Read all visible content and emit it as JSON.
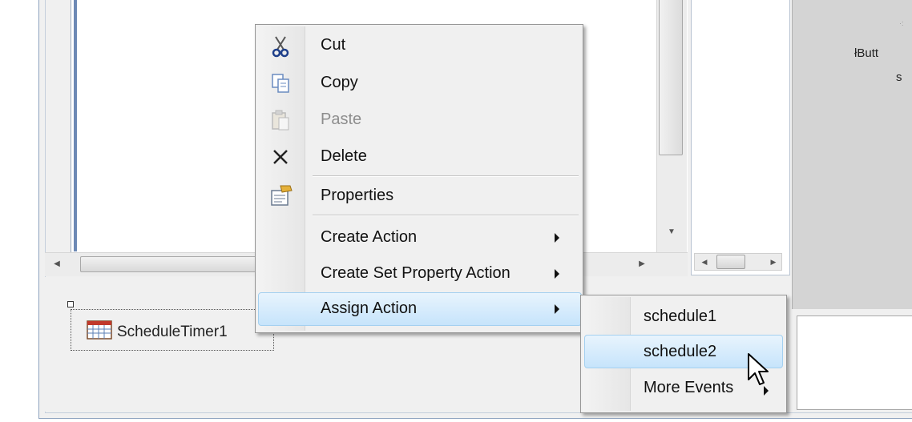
{
  "context_menu": {
    "items": [
      {
        "label": "Cut",
        "icon": "scissors-icon",
        "enabled": true
      },
      {
        "label": "Copy",
        "icon": "copy-icon",
        "enabled": true
      },
      {
        "label": "Paste",
        "icon": "paste-icon",
        "enabled": false
      },
      {
        "label": "Delete",
        "icon": "delete-x-icon",
        "enabled": true
      },
      {
        "label": "Properties",
        "icon": "properties-icon",
        "enabled": true
      },
      {
        "label": "Create Action",
        "submenu": true
      },
      {
        "label": "Create Set Property Action",
        "submenu": true
      },
      {
        "label": "Assign Action",
        "submenu": true,
        "highlighted": true
      }
    ]
  },
  "submenu": {
    "items": [
      {
        "label": "schedule1"
      },
      {
        "label": "schedule2",
        "highlighted": true
      },
      {
        "label": "More Events",
        "submenu": true
      }
    ]
  },
  "tray": {
    "component_label": "ScheduleTimer1",
    "icon": "calendar-grid-icon"
  },
  "preview": {
    "text": "Butt",
    "sub_text": "s",
    "marker": "ł"
  },
  "colors": {
    "highlight": "#c6e4fb",
    "highlight_border": "#a4d0f0",
    "canvas_border": "#6d89b5"
  }
}
